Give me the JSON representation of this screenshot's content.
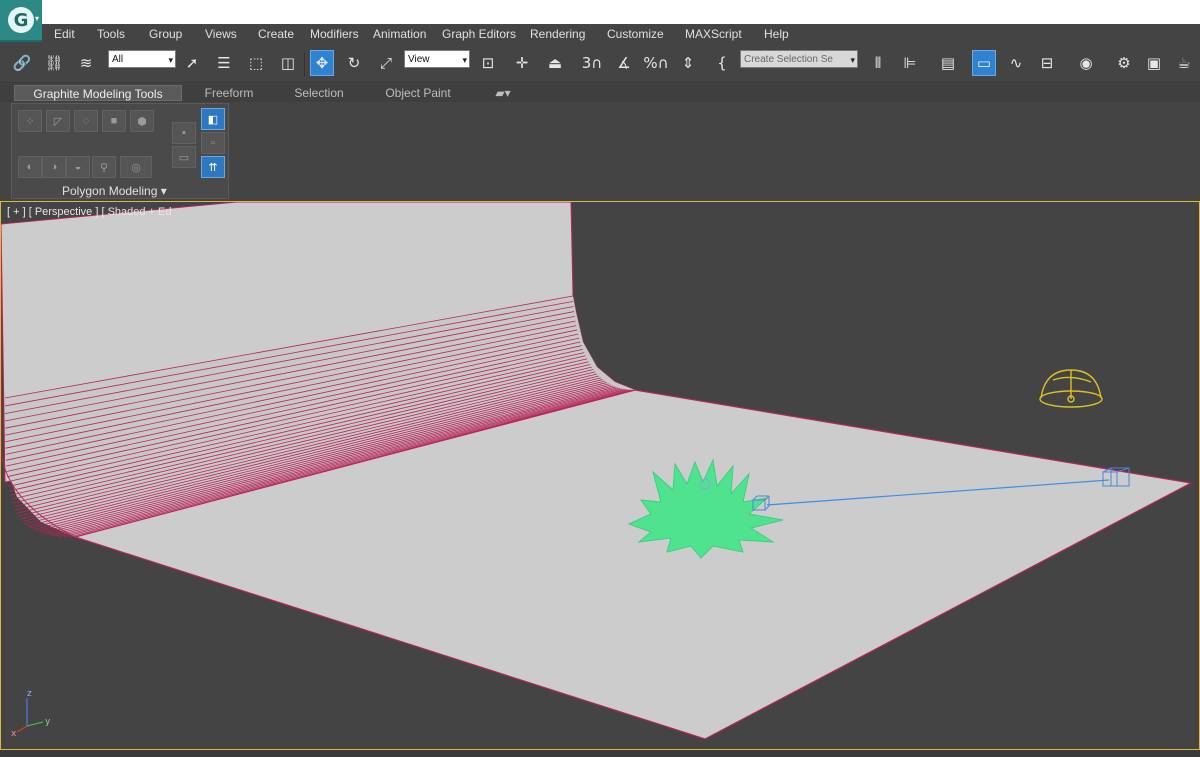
{
  "menu": [
    "Edit",
    "Tools",
    "Group",
    "Views",
    "Create",
    "Modifiers",
    "Animation",
    "Graph Editors",
    "Rendering",
    "Customize",
    "MAXScript",
    "Help"
  ],
  "toolbar": {
    "selection_filter": "All",
    "reference_coord": "View",
    "named_selection_placeholder": "Create Selection Se",
    "snap_3d_label": "3",
    "percent_snap_label": "%"
  },
  "ribbon": {
    "tabs": [
      "Graphite Modeling Tools",
      "Freeform",
      "Selection",
      "Object Paint"
    ],
    "active_tab": "Graphite Modeling Tools",
    "group_label": "Polygon Modeling"
  },
  "viewport": {
    "label": "[ + ] [ Perspective ] [ Shaded + Edged Faces ]",
    "visible_label": "[ + ] [ Perspective ] [ Shaded + Ed",
    "axis_labels": {
      "z": "z",
      "x": "x",
      "y": "y"
    },
    "border_color": "#e0b640",
    "background_color": "#444444",
    "floor_color": "#cccccc",
    "edge_color": "#b8245a",
    "plant_color": "#4fe38f",
    "light_color": "#e0c020",
    "camera_color": "#3c8ee6"
  }
}
